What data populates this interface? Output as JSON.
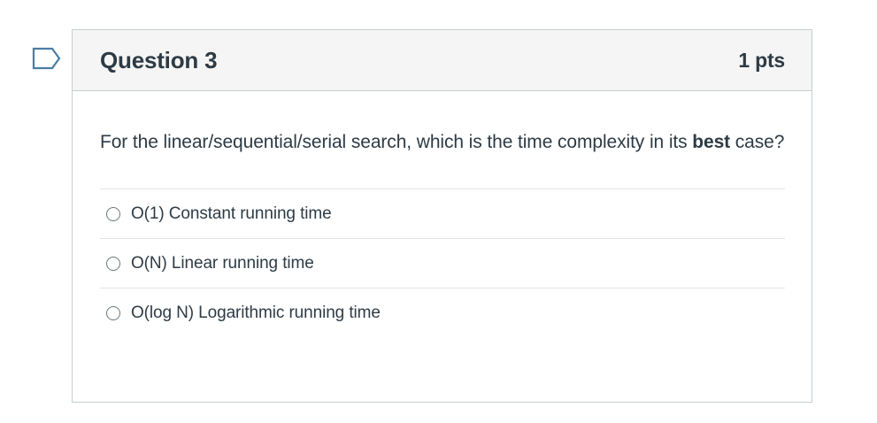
{
  "question": {
    "title": "Question 3",
    "points": "1 pts",
    "text_before": "For the linear/sequential/serial search, which is the time complexity in its ",
    "text_emphasis": "best",
    "text_after": " case?",
    "answers": [
      {
        "label": "O(1) Constant running time",
        "selected": false
      },
      {
        "label": "O(N) Linear running time",
        "selected": false
      },
      {
        "label": "O(log N) Logarithmic running time",
        "selected": false
      }
    ]
  },
  "icons": {
    "flag": "flag-question-icon"
  },
  "colors": {
    "text": "#2d3b45",
    "header_bg": "#f5f5f5",
    "border": "#c7cdd1",
    "flag_outline": "#4a7ea3"
  }
}
